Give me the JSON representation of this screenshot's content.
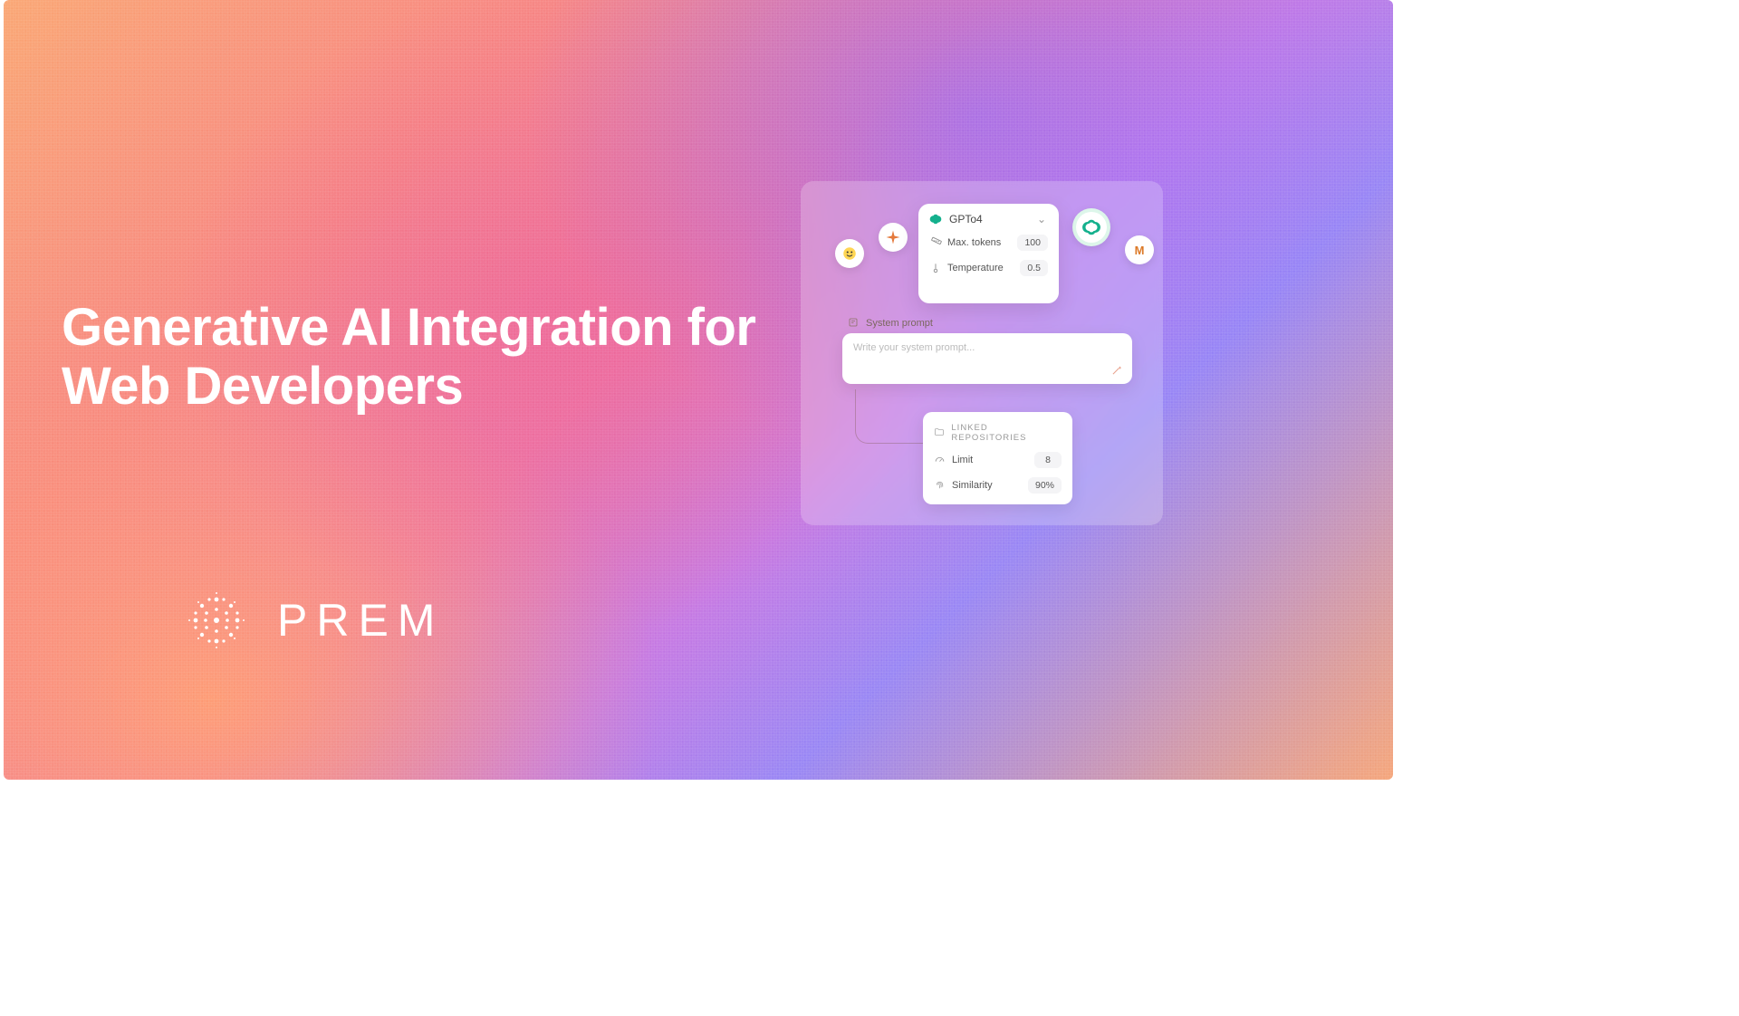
{
  "headline": {
    "line1": "Generative AI Integration for",
    "line2": "Web Developers"
  },
  "brand": {
    "name": "PREM"
  },
  "panel": {
    "model": {
      "selected": "GPTo4",
      "icon": "openai-icon",
      "params": {
        "max_tokens": {
          "label": "Max. tokens",
          "value": "100"
        },
        "temperature": {
          "label": "Temperature",
          "value": "0.5"
        }
      }
    },
    "bubbles": {
      "b1": "hf",
      "b2": "spark",
      "b3": "openai",
      "b4": "M"
    },
    "system_prompt": {
      "label": "System prompt",
      "placeholder": "Write your system prompt..."
    },
    "linked_repos": {
      "title": "LINKED REPOSITORIES",
      "limit": {
        "label": "Limit",
        "value": "8"
      },
      "similarity": {
        "label": "Similarity",
        "value": "90%"
      }
    }
  }
}
